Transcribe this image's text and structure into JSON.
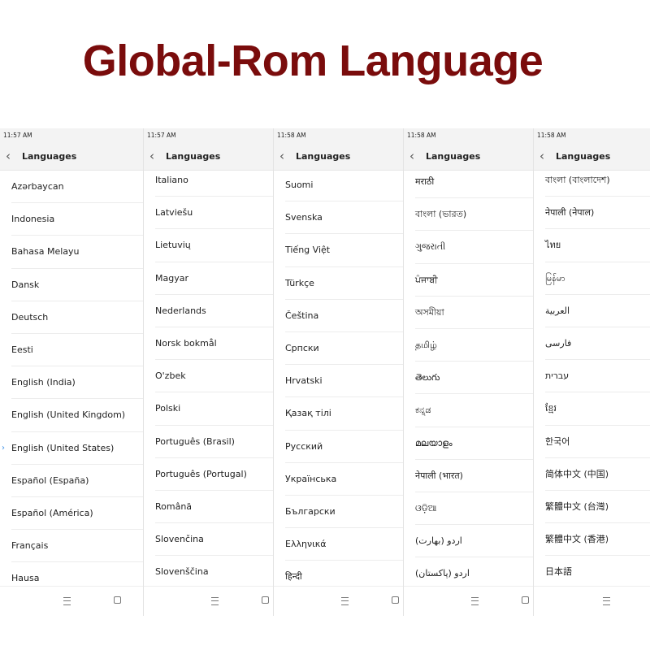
{
  "banner": {
    "title": "Global-Rom Language"
  },
  "accent_color": "#7a0c0c",
  "selected_marker_color": "#3a8ee6",
  "panels": [
    {
      "time": "11:57 AM",
      "title": "Languages",
      "selected_index": 8,
      "items": [
        "Azərbaycan",
        "Indonesia",
        "Bahasa Melayu",
        "Dansk",
        "Deutsch",
        "Eesti",
        "English (India)",
        "English (United Kingdom)",
        "English (United States)",
        "Español (España)",
        "Español (América)",
        "Français",
        "Hausa"
      ]
    },
    {
      "time": "11:57 AM",
      "title": "Languages",
      "selected_index": -1,
      "items": [
        "Italiano",
        "Latviešu",
        "Lietuvių",
        "Magyar",
        "Nederlands",
        "Norsk bokmål",
        "O'zbek",
        "Polski",
        "Português (Brasil)",
        "Português (Portugal)",
        "Română",
        "Slovenčina",
        "Slovenščina"
      ]
    },
    {
      "time": "11:58 AM",
      "title": "Languages",
      "selected_index": -1,
      "items": [
        "Suomi",
        "Svenska",
        "Tiếng Việt",
        "Türkçe",
        "Čeština",
        "Српски",
        "Hrvatski",
        "Қазақ тілі",
        "Русский",
        "Українська",
        "Български",
        "Ελληνικά",
        "हिन्दी"
      ]
    },
    {
      "time": "11:58 AM",
      "title": "Languages",
      "selected_index": -1,
      "items": [
        "मराठी",
        "বাংলা (ভারত)",
        "ગુજરાતી",
        "ਪੰਜਾਬੀ",
        "অসমীয়া",
        "தமிழ்",
        "తెలుగు",
        "ಕನ್ನಡ",
        "മലയാളം",
        "नेपाली (भारत)",
        "ଓଡ଼ିଆ",
        "اردو (بھارت)",
        "اردو (پاکستان)"
      ]
    },
    {
      "time": "11:58 AM",
      "title": "Languages",
      "selected_index": -1,
      "items": [
        "বাংলা (বাংলাদেশ)",
        "नेपाली (नेपाल)",
        "ไทย",
        "မြန်မာ",
        "العربية",
        "فارسی",
        "עברית",
        "ខ្មែរ",
        "한국어",
        "简体中文 (中国)",
        "繁體中文 (台灣)",
        "繁體中文 (香港)",
        "日本語"
      ]
    }
  ],
  "icons": {
    "back": "chevron-left-icon",
    "selected": "chevron-right-icon",
    "menu": "menu-icon",
    "overview": "square-icon"
  }
}
